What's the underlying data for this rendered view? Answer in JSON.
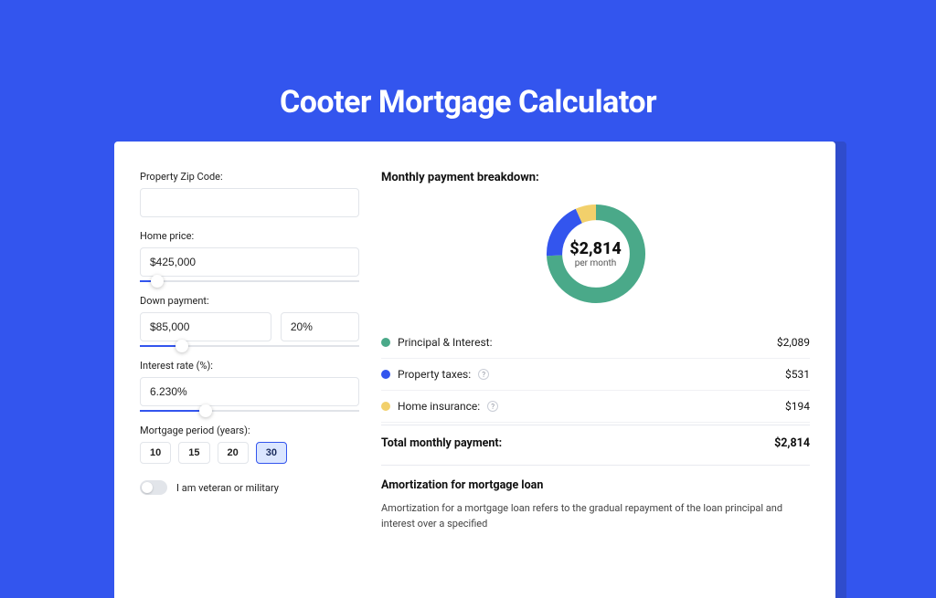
{
  "colors": {
    "primary": "#3355ee",
    "green": "#4aa989",
    "yellow": "#f2d06b"
  },
  "hero": {
    "title": "Cooter Mortgage Calculator"
  },
  "form": {
    "zip": {
      "label": "Property Zip Code:",
      "value": ""
    },
    "home_price": {
      "label": "Home price:",
      "value": "$425,000",
      "slider_percent": 8
    },
    "down_payment": {
      "label": "Down payment:",
      "amount": "$85,000",
      "percent": "20%",
      "slider_percent": 19
    },
    "interest_rate": {
      "label": "Interest rate (%):",
      "value": "6.230%",
      "slider_percent": 30
    },
    "period": {
      "label": "Mortgage period (years):",
      "options": [
        "10",
        "15",
        "20",
        "30"
      ],
      "selected": "30"
    },
    "veteran": {
      "label": "I am veteran or military",
      "value": false
    }
  },
  "summary": {
    "heading": "Monthly payment breakdown:",
    "donut": {
      "amount": "$2,814",
      "sub": "per month"
    },
    "items": [
      {
        "swatch": "green",
        "label": "Principal & Interest:",
        "info": false,
        "value": "$2,089"
      },
      {
        "swatch": "blue",
        "label": "Property taxes:",
        "info": true,
        "value": "$531"
      },
      {
        "swatch": "yellow",
        "label": "Home insurance:",
        "info": true,
        "value": "$194"
      }
    ],
    "total": {
      "label": "Total monthly payment:",
      "value": "$2,814"
    }
  },
  "amortization": {
    "heading": "Amortization for mortgage loan",
    "body": "Amortization for a mortgage loan refers to the gradual repayment of the loan principal and interest over a specified"
  },
  "chart_data": {
    "type": "pie",
    "title": "Monthly payment breakdown",
    "series": [
      {
        "name": "Principal & Interest",
        "value": 2089,
        "color": "#4aa989"
      },
      {
        "name": "Property taxes",
        "value": 531,
        "color": "#3355ee"
      },
      {
        "name": "Home insurance",
        "value": 194,
        "color": "#f2d06b"
      }
    ],
    "total": 2814,
    "center_label": "$2,814 per month"
  }
}
